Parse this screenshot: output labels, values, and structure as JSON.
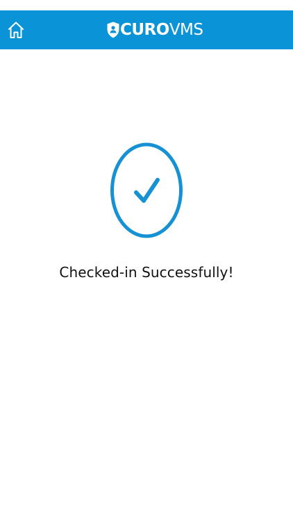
{
  "header": {
    "logo_bold": "CURO",
    "logo_light": "VMS",
    "home_icon": "home-icon",
    "background_color": "#0a93d6"
  },
  "main": {
    "status_icon": "check-circle-icon",
    "accent_color": "#1591d4",
    "message": "Checked-in Successfully!"
  }
}
